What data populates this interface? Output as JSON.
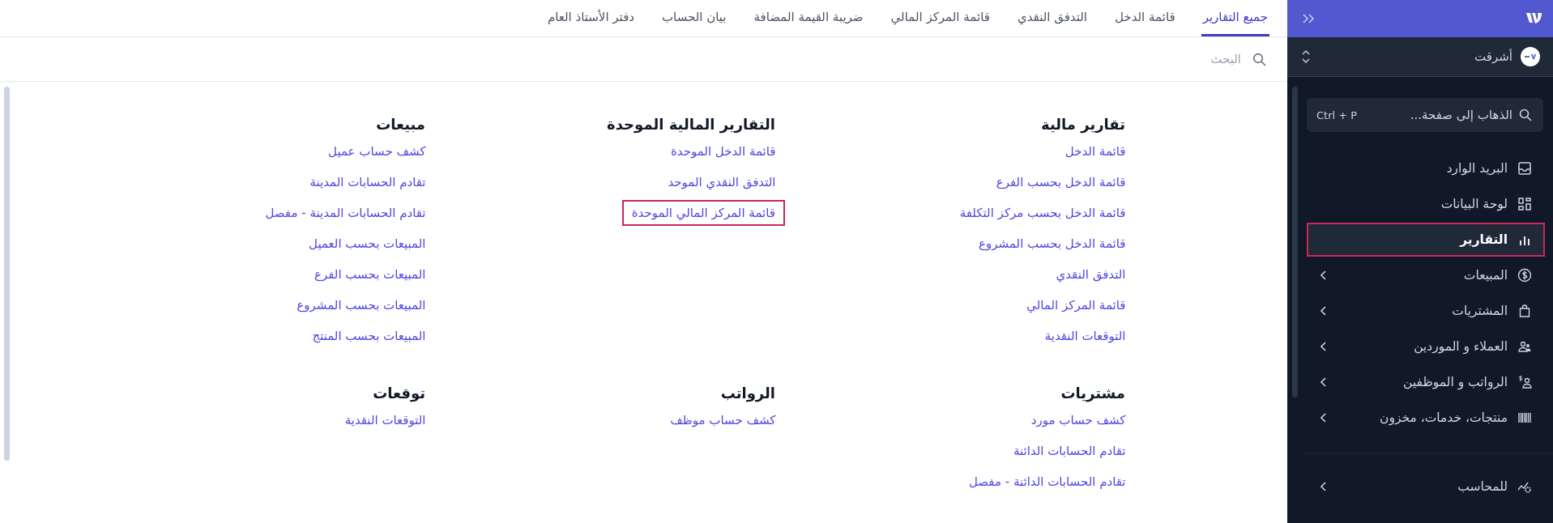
{
  "tabs": [
    {
      "label": "جميع التقارير",
      "selected": true
    },
    {
      "label": "قائمة الدخل",
      "selected": false
    },
    {
      "label": "التدفق النقدي",
      "selected": false
    },
    {
      "label": "قائمة المركز المالي",
      "selected": false
    },
    {
      "label": "ضريبة القيمة المضافة",
      "selected": false
    },
    {
      "label": "بيان الحساب",
      "selected": false
    },
    {
      "label": "دفتر الأستاذ العام",
      "selected": false
    }
  ],
  "search": {
    "placeholder": "البحث"
  },
  "sections": [
    {
      "title": "تقارير مالية",
      "links": [
        {
          "label": "قائمة الدخل",
          "highlighted": false
        },
        {
          "label": "قائمة الدخل بحسب الفرع",
          "highlighted": false
        },
        {
          "label": "قائمة الدخل بحسب مركز التكلفة",
          "highlighted": false
        },
        {
          "label": "قائمة الدخل بحسب المشروع",
          "highlighted": false
        },
        {
          "label": "التدفق النقدي",
          "highlighted": false
        },
        {
          "label": "قائمة المركز المالي",
          "highlighted": false
        },
        {
          "label": "التوقعات النقدية",
          "highlighted": false
        }
      ]
    },
    {
      "title": "التقارير المالية الموحدة",
      "links": [
        {
          "label": "قائمة الدخل الموحدة",
          "highlighted": false
        },
        {
          "label": "التدفق النقدي الموحد",
          "highlighted": false
        },
        {
          "label": "قائمة المركز المالي الموحدة",
          "highlighted": true
        }
      ]
    },
    {
      "title": "مبيعات",
      "links": [
        {
          "label": "كشف حساب عميل",
          "highlighted": false
        },
        {
          "label": "تقادم الحسابات المدينة",
          "highlighted": false
        },
        {
          "label": "تقادم الحسابات المدينة - مفصل",
          "highlighted": false
        },
        {
          "label": "المبيعات بحسب العميل",
          "highlighted": false
        },
        {
          "label": "المبيعات بحسب الفرع",
          "highlighted": false
        },
        {
          "label": "المبيعات بحسب المشروع",
          "highlighted": false
        },
        {
          "label": "المبيعات بحسب المنتج",
          "highlighted": false
        }
      ]
    },
    {
      "title": "مشتريات",
      "links": [
        {
          "label": "كشف حساب مورد",
          "highlighted": false
        },
        {
          "label": "تقادم الحسابات الدائنة",
          "highlighted": false
        },
        {
          "label": "تقادم الحسابات الدائنة - مفصل",
          "highlighted": false
        }
      ]
    },
    {
      "title": "الرواتب",
      "links": [
        {
          "label": "كشف حساب موظف",
          "highlighted": false
        }
      ]
    },
    {
      "title": "توقعات",
      "links": [
        {
          "label": "التوقعات النقدية",
          "highlighted": false
        }
      ]
    }
  ],
  "sidebar": {
    "organization": "أشرقت",
    "goto": {
      "placeholder": "الذهاب إلى صفحة...",
      "shortcut": "Ctrl + P"
    },
    "items": [
      {
        "label": "البريد الوارد",
        "selected": false,
        "expandable": false,
        "highlighted": false
      },
      {
        "label": "لوحة البيانات",
        "selected": false,
        "expandable": false,
        "highlighted": false
      },
      {
        "label": "التقارير",
        "selected": true,
        "expandable": false,
        "highlighted": true
      },
      {
        "label": "المبيعات",
        "selected": false,
        "expandable": true,
        "highlighted": false
      },
      {
        "label": "المشتريات",
        "selected": false,
        "expandable": true,
        "highlighted": false
      },
      {
        "label": "العملاء و الموردين",
        "selected": false,
        "expandable": true,
        "highlighted": false
      },
      {
        "label": "الرواتب و الموظفين",
        "selected": false,
        "expandable": true,
        "highlighted": false
      },
      {
        "label": "منتجات، خدمات، مخزون",
        "selected": false,
        "expandable": true,
        "highlighted": false
      }
    ],
    "bottom_items": [
      {
        "label": "للمحاسب",
        "selected": false,
        "expandable": true,
        "highlighted": false
      }
    ]
  }
}
